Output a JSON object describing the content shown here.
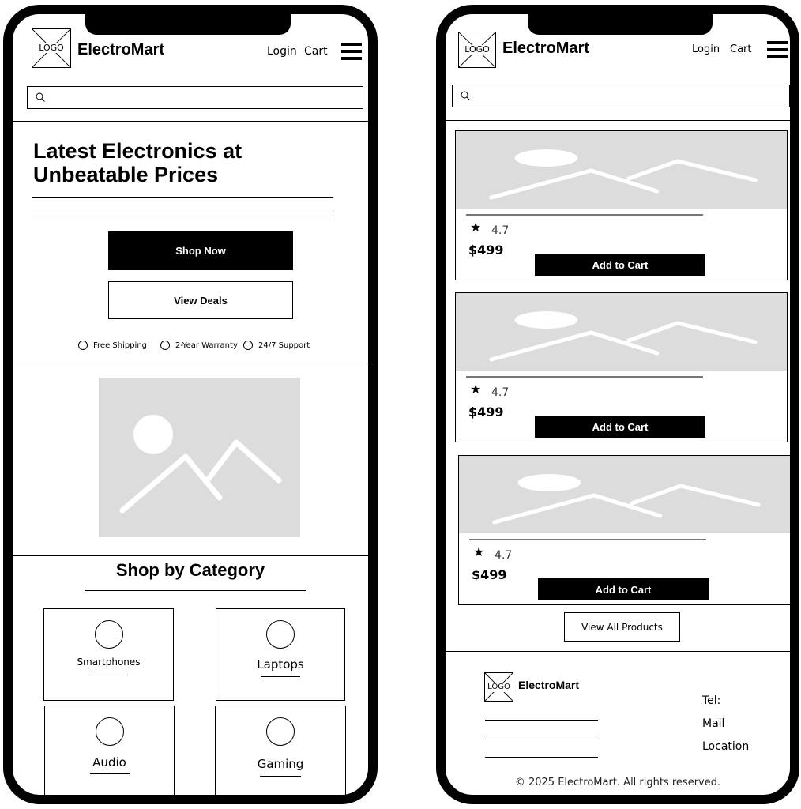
{
  "left_phone": {
    "header": {
      "logo_text": "LOGO",
      "brand": "ElectroMart",
      "login": "Login",
      "cart": "Cart"
    },
    "search": {
      "placeholder": "",
      "value": ""
    },
    "hero": {
      "title": "Latest Electronics at Unbeatable Prices",
      "primary_button": "Shop Now",
      "secondary_button": "View Deals",
      "features": [
        "Free Shipping",
        "2-Year Warranty",
        "24/7 Support"
      ]
    },
    "categories": {
      "title": "Shop by Category",
      "items": [
        "Smartphones",
        "Laptops",
        "Audio",
        "Gaming"
      ]
    }
  },
  "right_phone": {
    "header": {
      "logo_text": "LOGO",
      "brand": "ElectroMart",
      "login": "Login",
      "cart": "Cart"
    },
    "search": {
      "placeholder": "",
      "value": ""
    },
    "products": [
      {
        "rating": "4.7",
        "price": "$499",
        "button": "Add to Cart"
      },
      {
        "rating": "4.7",
        "price": "$499",
        "button": "Add to Cart"
      },
      {
        "rating": "4.7",
        "price": "$499",
        "button": "Add to Cart"
      }
    ],
    "view_all": "View All Products",
    "footer": {
      "logo_text": "LOGO",
      "brand": "ElectroMart",
      "contact": [
        "Tel:",
        "Mail",
        "Location"
      ],
      "copyright": "© 2025 ElectroMart. All rights reserved."
    }
  },
  "icons": {
    "menu": "hamburger-menu-icon",
    "search": "search-icon",
    "rating": "star-icon",
    "logo": "logo-placeholder-icon",
    "image": "image-placeholder-icon",
    "feature": "circle-icon",
    "category": "circle-icon"
  },
  "colors": {
    "frame": "#000000",
    "background": "#ffffff",
    "placeholder": "#dcdcdc",
    "placeholder_art": "#ffffff"
  }
}
